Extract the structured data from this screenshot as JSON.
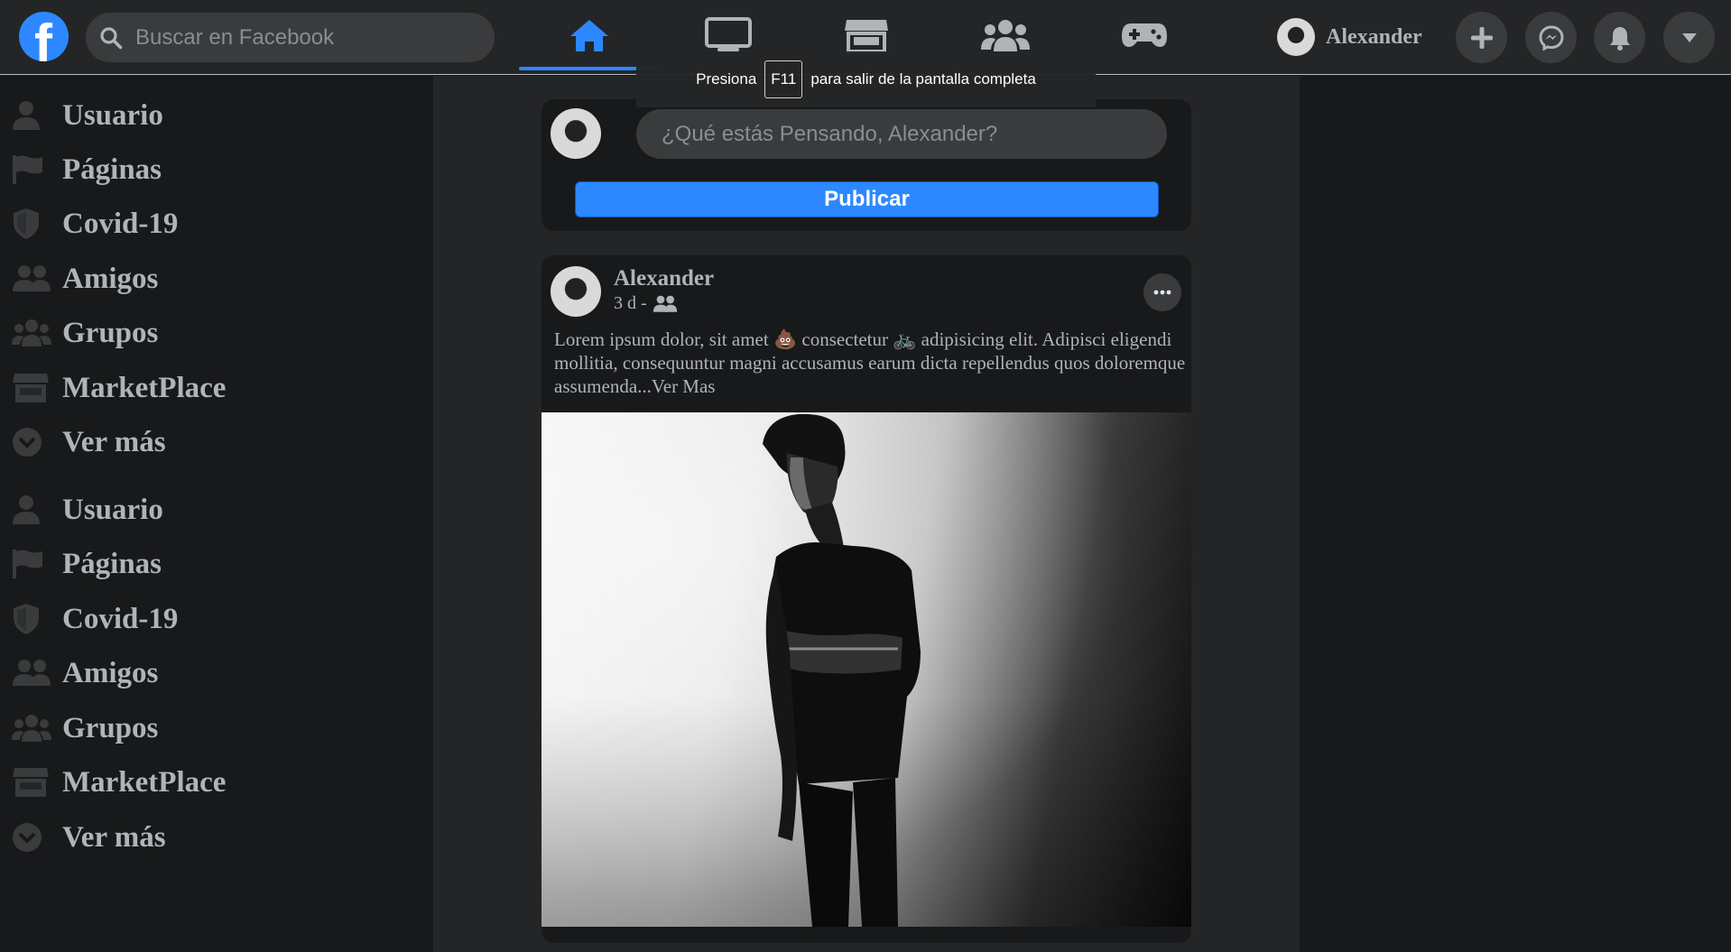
{
  "header": {
    "logo_letter": "f",
    "search_placeholder": "Buscar en Facebook",
    "nav_tabs": [
      {
        "icon": "home-icon",
        "active": true
      },
      {
        "icon": "watch-tv-icon",
        "active": false
      },
      {
        "icon": "marketplace-store-icon",
        "active": false
      },
      {
        "icon": "groups-icon",
        "active": false
      },
      {
        "icon": "gaming-controller-icon",
        "active": false
      }
    ],
    "profile_name": "Alexander",
    "action_icons": [
      "plus-icon",
      "messenger-icon",
      "bell-icon",
      "caret-down-icon"
    ],
    "accent_color": "#2d88ff"
  },
  "fullscreen_toast": {
    "before": "Presiona",
    "key": "F11",
    "after": "para salir de la pantalla completa"
  },
  "sidebar": {
    "items": [
      {
        "label": "Usuario",
        "icon": "user-icon"
      },
      {
        "label": "Páginas",
        "icon": "flag-icon"
      },
      {
        "label": "Covid-19",
        "icon": "shield-icon"
      },
      {
        "label": "Amigos",
        "icon": "friends-icon"
      },
      {
        "label": "Grupos",
        "icon": "groups-icon"
      },
      {
        "label": "MarketPlace",
        "icon": "store-icon"
      },
      {
        "label": "Ver más",
        "icon": "chevron-circle-down-icon"
      },
      {
        "label": "Usuario",
        "icon": "user-icon"
      },
      {
        "label": "Páginas",
        "icon": "flag-icon"
      },
      {
        "label": "Covid-19",
        "icon": "shield-icon"
      },
      {
        "label": "Amigos",
        "icon": "friends-icon"
      },
      {
        "label": "Grupos",
        "icon": "groups-icon"
      },
      {
        "label": "MarketPlace",
        "icon": "store-icon"
      },
      {
        "label": "Ver más",
        "icon": "chevron-circle-down-icon"
      }
    ]
  },
  "composer": {
    "placeholder": "¿Qué estás Pensando, Alexander?",
    "publish_label": "Publicar"
  },
  "post": {
    "author": "Alexander",
    "time": "3 d -",
    "audience_icon": "friends-icon",
    "text_part1": "Lorem ipsum dolor, sit amet",
    "emoji1": "💩",
    "text_part2": "consectetur",
    "emoji2": "🚲",
    "text_part3": "adipisicing elit. Adipisci eligendi mollitia, consequuntur magni accusamus earum dicta repellendus quos doloremque assumenda...",
    "see_more": "Ver Mas",
    "image_desc_icon": "post-photo"
  }
}
